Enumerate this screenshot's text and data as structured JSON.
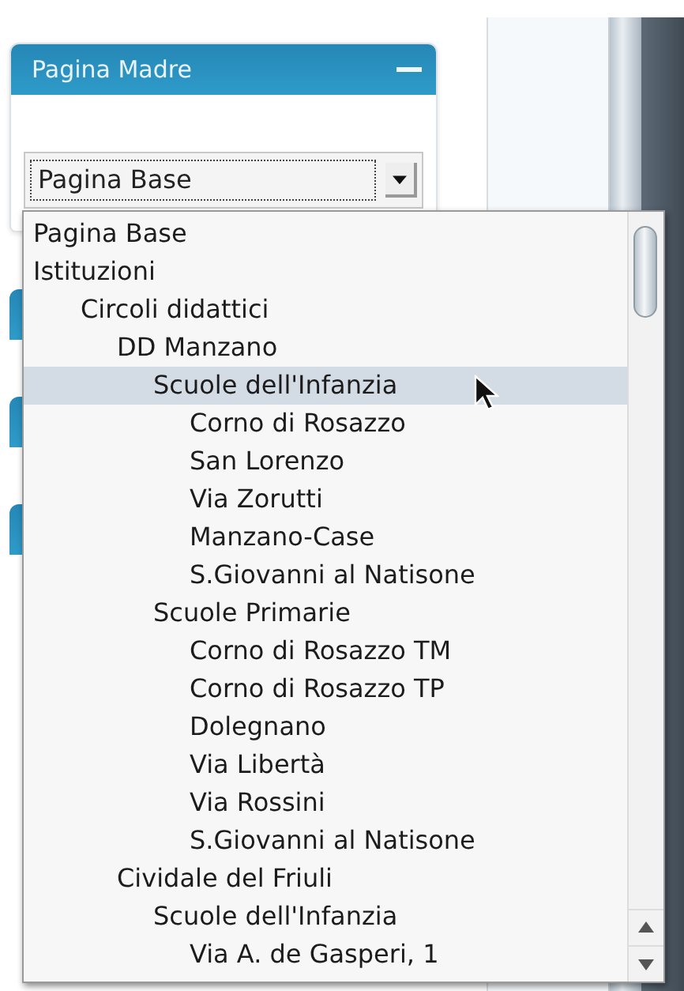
{
  "panel": {
    "title": "Pagina Madre",
    "expanded": true
  },
  "select": {
    "value": "Pagina Base"
  },
  "dropdown": {
    "options": [
      {
        "label": "Pagina Base",
        "highlighted": false
      },
      {
        "label": "Istituzioni",
        "highlighted": false,
        "children": [
          {
            "label": "Circoli didattici",
            "highlighted": false,
            "children": [
              {
                "label": "DD Manzano",
                "highlighted": false,
                "children": [
                  {
                    "label": "Scuole dell'Infanzia",
                    "highlighted": true,
                    "children": [
                      {
                        "label": "Corno di Rosazzo",
                        "highlighted": false
                      },
                      {
                        "label": "San Lorenzo",
                        "highlighted": false
                      },
                      {
                        "label": "Via Zorutti",
                        "highlighted": false
                      },
                      {
                        "label": "Manzano-Case",
                        "highlighted": false
                      },
                      {
                        "label": "S.Giovanni al Natisone",
                        "highlighted": false
                      }
                    ]
                  },
                  {
                    "label": "Scuole Primarie",
                    "highlighted": false,
                    "children": [
                      {
                        "label": "Corno di Rosazzo TM",
                        "highlighted": false
                      },
                      {
                        "label": "Corno di Rosazzo TP",
                        "highlighted": false
                      },
                      {
                        "label": "Dolegnano",
                        "highlighted": false
                      },
                      {
                        "label": "Via Libertà",
                        "highlighted": false
                      },
                      {
                        "label": "Via Rossini",
                        "highlighted": false
                      },
                      {
                        "label": "S.Giovanni al Natisone",
                        "highlighted": false
                      }
                    ]
                  }
                ]
              },
              {
                "label": "Cividale del Friuli",
                "highlighted": false,
                "children": [
                  {
                    "label": "Scuole dell'Infanzia",
                    "highlighted": false,
                    "children": [
                      {
                        "label": "Via A. de Gasperi, 1",
                        "highlighted": false
                      }
                    ]
                  }
                ]
              }
            ]
          }
        ]
      }
    ]
  }
}
